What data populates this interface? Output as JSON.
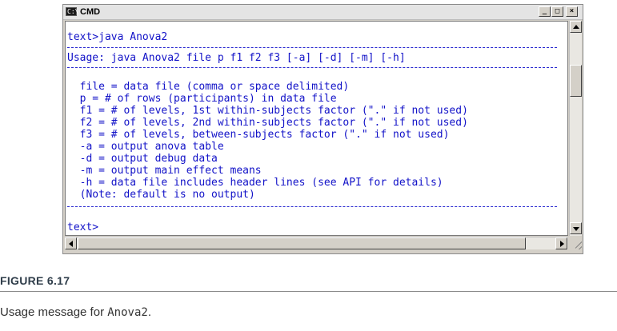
{
  "window": {
    "title": "CMD",
    "icon_text": "C:\\",
    "controls": {
      "minimize": "_",
      "maximize": "□",
      "close": "×"
    }
  },
  "console": {
    "prompt_command": "text>java Anova2",
    "usage": "Usage: java Anova2 file p f1 f2 f3 [-a] [-d] [-m] [-h]",
    "options": [
      "  file = data file (comma or space delimited)",
      "  p = # of rows (participants) in data file",
      "  f1 = # of levels, 1st within-subjects factor (\".\" if not used)",
      "  f2 = # of levels, 2nd within-subjects factor (\".\" if not used)",
      "  f3 = # of levels, between-subjects factor (\".\" if not used)",
      "  -a = output anova table",
      "  -d = output debug data",
      "  -m = output main effect means",
      "  -h = data file includes header lines (see API for details)",
      "  (Note: default is no output)"
    ],
    "final_prompt": "text>"
  },
  "colors": {
    "console_text": "#1212c8",
    "console_bg": "#ffffff"
  },
  "caption": {
    "figure_label": "FIGURE 6.17",
    "text_prefix": "Usage message for ",
    "code": "Anova2",
    "text_suffix": "."
  }
}
